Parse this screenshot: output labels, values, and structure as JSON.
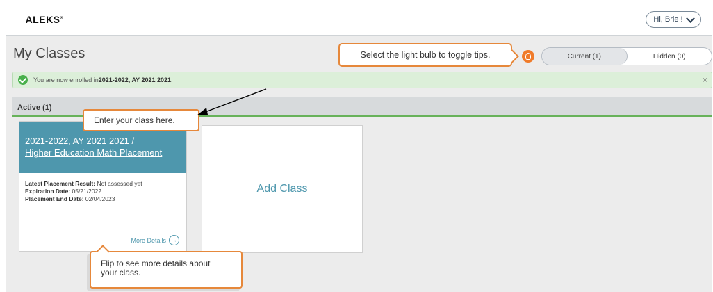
{
  "header": {
    "logo": "ALEKS",
    "logo_mark": "®",
    "user_greeting": "Hi, Brie !"
  },
  "page": {
    "title": "My Classes",
    "tip_text": "Select the light bulb to toggle tips.",
    "toggle": {
      "current": "Current (1)",
      "hidden": "Hidden (0)",
      "selected": "current"
    }
  },
  "notice": {
    "prefix": "You are now enrolled in ",
    "class_name": "2021-2022, AY 2021 2021",
    "suffix": ".",
    "close": "×"
  },
  "active": {
    "label": "Active (1)"
  },
  "card": {
    "title_line1": "2021-2022, AY 2021 2021 /",
    "title_line2": "Higher Education Math Placement",
    "result_label": "Latest Placement Result:",
    "result_value": " Not assessed yet",
    "expiration_label": "Expiration Date:",
    "expiration_value": " 05/21/2022",
    "end_label": "Placement End Date:",
    "end_value": " 02/04/2023",
    "more_details": "More Details",
    "more_icon": "→"
  },
  "add_class": {
    "label": "Add Class"
  },
  "callouts": {
    "enter_class": "Enter your class here.",
    "flip_line1": "Flip to see more details about",
    "flip_line2": "your class."
  },
  "colors": {
    "accent_teal": "#4e97ad",
    "tip_orange": "#e6883b",
    "success_green": "#49b04c"
  }
}
